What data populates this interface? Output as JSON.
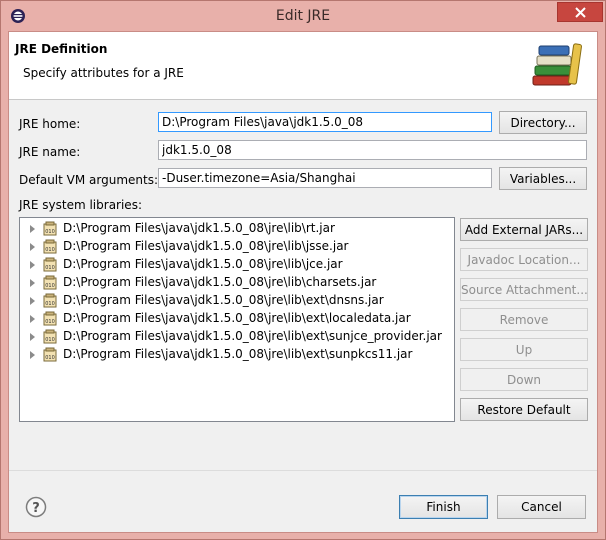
{
  "window": {
    "title": "Edit JRE"
  },
  "banner": {
    "title": "JRE Definition",
    "description": "Specify attributes for a JRE",
    "icon": "library-books-icon"
  },
  "form": {
    "jre_home_label": "JRE home:",
    "jre_home_value": "D:\\Program Files\\java\\jdk1.5.0_08",
    "directory_button": "Directory...",
    "jre_name_label": "JRE name:",
    "jre_name_value": "jdk1.5.0_08",
    "vm_args_label": "Default VM arguments:",
    "vm_args_value": "-Duser.timezone=Asia/Shanghai",
    "variables_button": "Variables...",
    "libraries_label": "JRE system libraries:"
  },
  "libraries": [
    "D:\\Program Files\\java\\jdk1.5.0_08\\jre\\lib\\rt.jar",
    "D:\\Program Files\\java\\jdk1.5.0_08\\jre\\lib\\jsse.jar",
    "D:\\Program Files\\java\\jdk1.5.0_08\\jre\\lib\\jce.jar",
    "D:\\Program Files\\java\\jdk1.5.0_08\\jre\\lib\\charsets.jar",
    "D:\\Program Files\\java\\jdk1.5.0_08\\jre\\lib\\ext\\dnsns.jar",
    "D:\\Program Files\\java\\jdk1.5.0_08\\jre\\lib\\ext\\localedata.jar",
    "D:\\Program Files\\java\\jdk1.5.0_08\\jre\\lib\\ext\\sunjce_provider.jar",
    "D:\\Program Files\\java\\jdk1.5.0_08\\jre\\lib\\ext\\sunpkcs11.jar"
  ],
  "lib_buttons": {
    "add_external_jars": "Add External JARs...",
    "javadoc_location": "Javadoc Location...",
    "source_attachment": "Source Attachment...",
    "remove": "Remove",
    "up": "Up",
    "down": "Down",
    "restore_default": "Restore Default"
  },
  "footer": {
    "finish": "Finish",
    "cancel": "Cancel"
  },
  "colors": {
    "frame": "#e8b0aa",
    "close": "#c7463f",
    "focus": "#3399ff"
  }
}
